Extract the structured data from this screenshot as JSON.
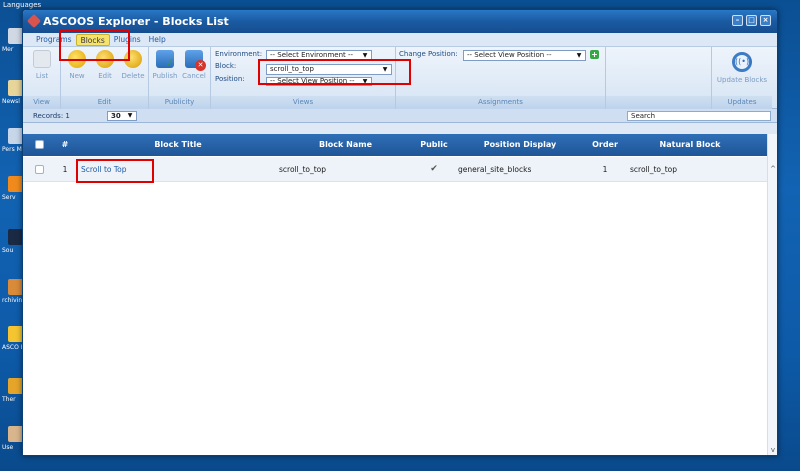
{
  "desktop": {
    "topbar": "Languages",
    "icons": [
      {
        "label": "Mer",
        "color": "#d0d8e4"
      },
      {
        "label": "Newsl",
        "color": "#e8d59a"
      },
      {
        "label": "Pers Mess",
        "color": "#c8d6ea"
      },
      {
        "label": "Serv",
        "color": "#f08a1c"
      },
      {
        "label": "Sou",
        "color": "#1b2a44"
      },
      {
        "label": "rchiving",
        "color": "#d98b3a"
      },
      {
        "label": "ASCO Explo",
        "color": "#f4c531"
      },
      {
        "label": "Ther",
        "color": "#e5a52a"
      },
      {
        "label": "Use",
        "color": "#d8b58c"
      }
    ]
  },
  "window": {
    "title": "ASCOOS Explorer - Blocks List",
    "menu": [
      "Programs",
      "Blocks",
      "Plugins",
      "Help"
    ],
    "ribbon": {
      "view_group": {
        "caption": "View",
        "list": "List"
      },
      "edit_group": {
        "caption": "Edit",
        "new": "New",
        "edit": "Edit",
        "delete": "Delete"
      },
      "publicity_group": {
        "caption": "Publicity",
        "publish": "Publish",
        "cancel": "Cancel"
      },
      "views_group": {
        "caption": "Views",
        "environment_label": "Environment:",
        "environment_value": "-- Select Environment --",
        "block_label": "Block:",
        "block_value": "scroll_to_top",
        "position_label": "Position:",
        "position_value": "-- Select View Position --"
      },
      "assignments_group": {
        "caption": "Assignments",
        "change_position_label": "Change Position:",
        "change_position_value": "-- Select View Position --"
      },
      "updates_group": {
        "caption": "Updates",
        "update_blocks": "Update Blocks"
      }
    },
    "records": {
      "label": "Records: 1",
      "per_page": "30",
      "search_placeholder": "Search"
    },
    "table": {
      "columns": [
        "#",
        "Block Title",
        "Block Name",
        "Public",
        "Position Display",
        "Order",
        "Natural Block"
      ],
      "rows": [
        {
          "num": "1",
          "title": "Scroll to Top",
          "name": "scroll_to_top",
          "public": "✔",
          "position": "general_site_blocks",
          "order": "1",
          "natural": "scroll_to_top"
        }
      ]
    }
  }
}
